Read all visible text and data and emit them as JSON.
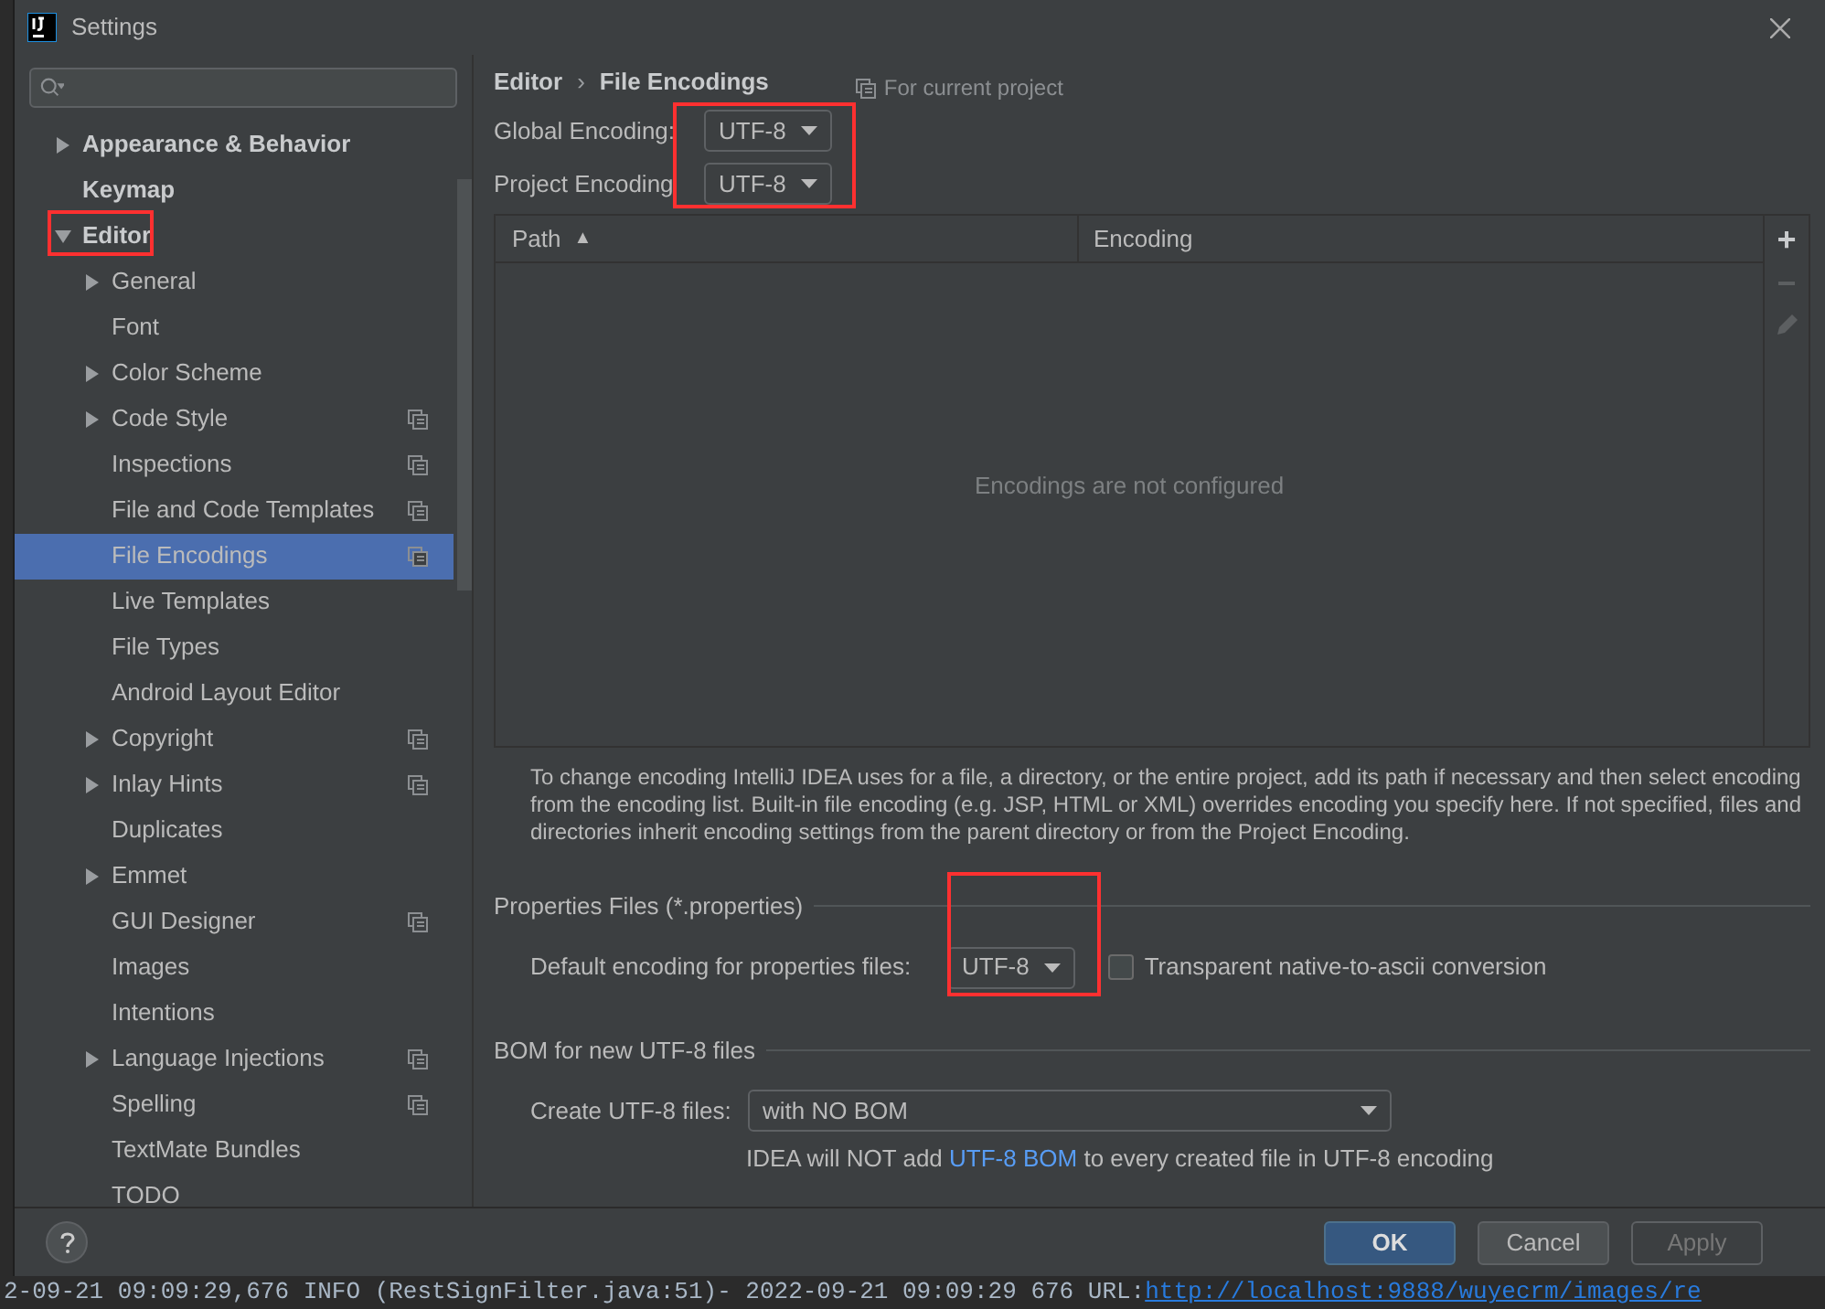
{
  "window": {
    "title": "Settings"
  },
  "tree": [
    {
      "label": "Appearance & Behavior",
      "bold": true,
      "expandable": true,
      "expanded": false,
      "selected": false,
      "project": false
    },
    {
      "label": "Keymap",
      "bold": true,
      "expandable": false,
      "selected": false,
      "project": false
    },
    {
      "label": "Editor",
      "bold": true,
      "expandable": true,
      "expanded": true,
      "selected": false,
      "project": false,
      "highlighted": true,
      "children": [
        {
          "label": "General",
          "expandable": true,
          "expanded": false,
          "selected": false,
          "project": false
        },
        {
          "label": "Font",
          "expandable": false,
          "selected": false,
          "project": false
        },
        {
          "label": "Color Scheme",
          "expandable": true,
          "expanded": false,
          "selected": false,
          "project": false
        },
        {
          "label": "Code Style",
          "expandable": true,
          "expanded": false,
          "selected": false,
          "project": true
        },
        {
          "label": "Inspections",
          "expandable": false,
          "selected": false,
          "project": true
        },
        {
          "label": "File and Code Templates",
          "expandable": false,
          "selected": false,
          "project": true
        },
        {
          "label": "File Encodings",
          "expandable": false,
          "selected": true,
          "project": true
        },
        {
          "label": "Live Templates",
          "expandable": false,
          "selected": false,
          "project": false
        },
        {
          "label": "File Types",
          "expandable": false,
          "selected": false,
          "project": false
        },
        {
          "label": "Android Layout Editor",
          "expandable": false,
          "selected": false,
          "project": false
        },
        {
          "label": "Copyright",
          "expandable": true,
          "expanded": false,
          "selected": false,
          "project": true
        },
        {
          "label": "Inlay Hints",
          "expandable": true,
          "expanded": false,
          "selected": false,
          "project": true
        },
        {
          "label": "Duplicates",
          "expandable": false,
          "selected": false,
          "project": false
        },
        {
          "label": "Emmet",
          "expandable": true,
          "expanded": false,
          "selected": false,
          "project": false
        },
        {
          "label": "GUI Designer",
          "expandable": false,
          "selected": false,
          "project": true
        },
        {
          "label": "Images",
          "expandable": false,
          "selected": false,
          "project": false
        },
        {
          "label": "Intentions",
          "expandable": false,
          "selected": false,
          "project": false
        },
        {
          "label": "Language Injections",
          "expandable": true,
          "expanded": false,
          "selected": false,
          "project": true
        },
        {
          "label": "Spelling",
          "expandable": false,
          "selected": false,
          "project": true
        },
        {
          "label": "TextMate Bundles",
          "expandable": false,
          "selected": false,
          "project": false
        },
        {
          "label": "TODO",
          "expandable": false,
          "selected": false,
          "project": false
        }
      ]
    }
  ],
  "breadcrumb": {
    "parent": "Editor",
    "separator": "›",
    "current": "File Encodings",
    "scope": "For current project"
  },
  "encodings": {
    "highlighted": true,
    "rows": [
      {
        "label": "Global Encoding:",
        "value": "UTF-8"
      },
      {
        "label": "Project Encoding",
        "value": "UTF-8"
      }
    ]
  },
  "table": {
    "columns": [
      {
        "label": "Path",
        "sort": "▲"
      },
      {
        "label": "Encoding"
      }
    ],
    "empty_text": "Encodings are not configured",
    "tools": [
      {
        "label": "+",
        "disabled": false
      },
      {
        "label": "−",
        "disabled": true
      },
      {
        "kind": "edit",
        "disabled": true
      }
    ]
  },
  "description": "To change encoding IntelliJ IDEA uses for a file, a directory, or the entire project, add its path if necessary and then select encoding from the encoding list. Built-in file encoding (e.g. JSP, HTML or XML) overrides encoding you specify here. If not specified, files and directories inherit encoding settings from the parent directory or from the Project Encoding.",
  "properties": {
    "title": "Properties Files (*.properties)",
    "label": "Default encoding for properties files:",
    "value": "UTF-8",
    "highlighted": true,
    "checkbox": {
      "label": "Transparent native-to-ascii conversion",
      "checked": false
    }
  },
  "bom": {
    "title": "BOM for new UTF-8 files",
    "label": "Create UTF-8 files:",
    "value": "with NO BOM",
    "note_before": "IDEA will NOT add ",
    "note_link": "UTF-8 BOM",
    "note_after": " to every created file in UTF-8 encoding"
  },
  "buttons": [
    {
      "label": "OK",
      "kind": "primary",
      "disabled": false
    },
    {
      "label": "Cancel",
      "kind": "normal",
      "disabled": false
    },
    {
      "label": "Apply",
      "kind": "normal",
      "disabled": true
    }
  ],
  "background_log": {
    "text": "2-09-21 09:09:29,676 INFO (RestSignFilter.java:51)- 2022-09-21 09:09:29 676 URL: ",
    "link": "http://localhost:9888/wuyecrm/images/re"
  }
}
